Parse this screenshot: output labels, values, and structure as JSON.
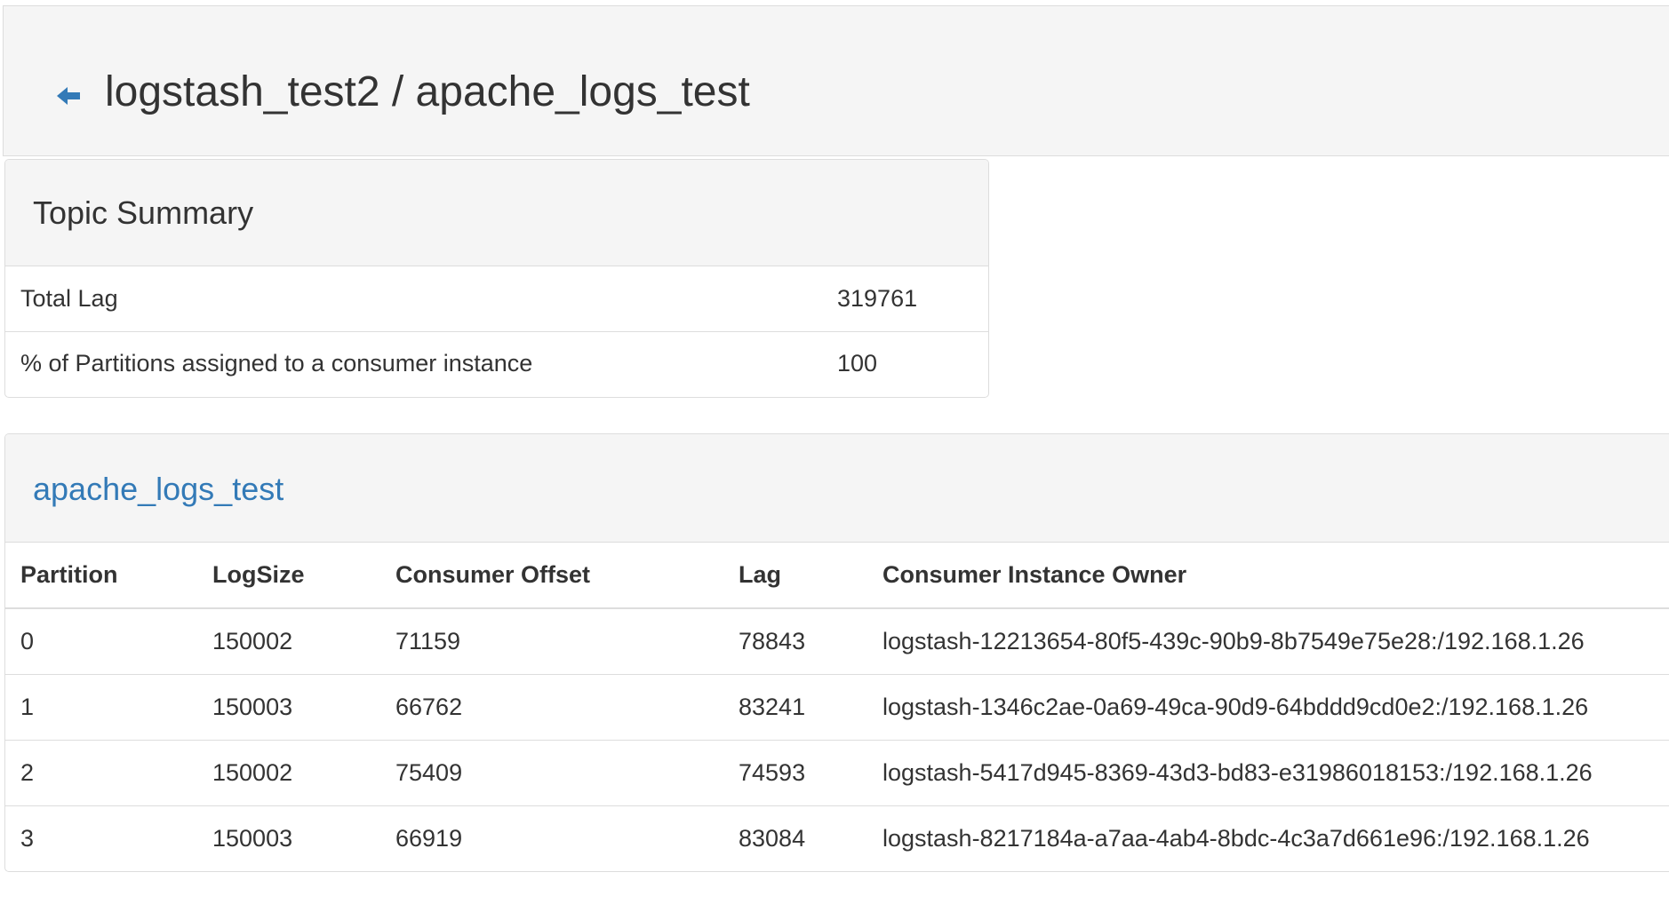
{
  "header": {
    "back_icon": "arrow-left-icon",
    "title": "logstash_test2 / apache_logs_test"
  },
  "colors": {
    "link": "#337ab7",
    "panel_heading_bg": "#f5f5f5",
    "border": "#dddddd",
    "text": "#333333"
  },
  "summary": {
    "title": "Topic Summary",
    "rows": [
      {
        "label": "Total Lag",
        "value": "319761"
      },
      {
        "label": "% of Partitions assigned to a consumer instance",
        "value": "100"
      }
    ]
  },
  "partitions": {
    "topic_link": "apache_logs_test",
    "columns": [
      "Partition",
      "LogSize",
      "Consumer Offset",
      "Lag",
      "Consumer Instance Owner"
    ],
    "rows": [
      [
        "0",
        "150002",
        "71159",
        "78843",
        "logstash-12213654-80f5-439c-90b9-8b7549e75e28:/192.168.1.26"
      ],
      [
        "1",
        "150003",
        "66762",
        "83241",
        "logstash-1346c2ae-0a69-49ca-90d9-64bddd9cd0e2:/192.168.1.26"
      ],
      [
        "2",
        "150002",
        "75409",
        "74593",
        "logstash-5417d945-8369-43d3-bd83-e31986018153:/192.168.1.26"
      ],
      [
        "3",
        "150003",
        "66919",
        "83084",
        "logstash-8217184a-a7aa-4ab4-8bdc-4c3a7d661e96:/192.168.1.26"
      ]
    ]
  }
}
